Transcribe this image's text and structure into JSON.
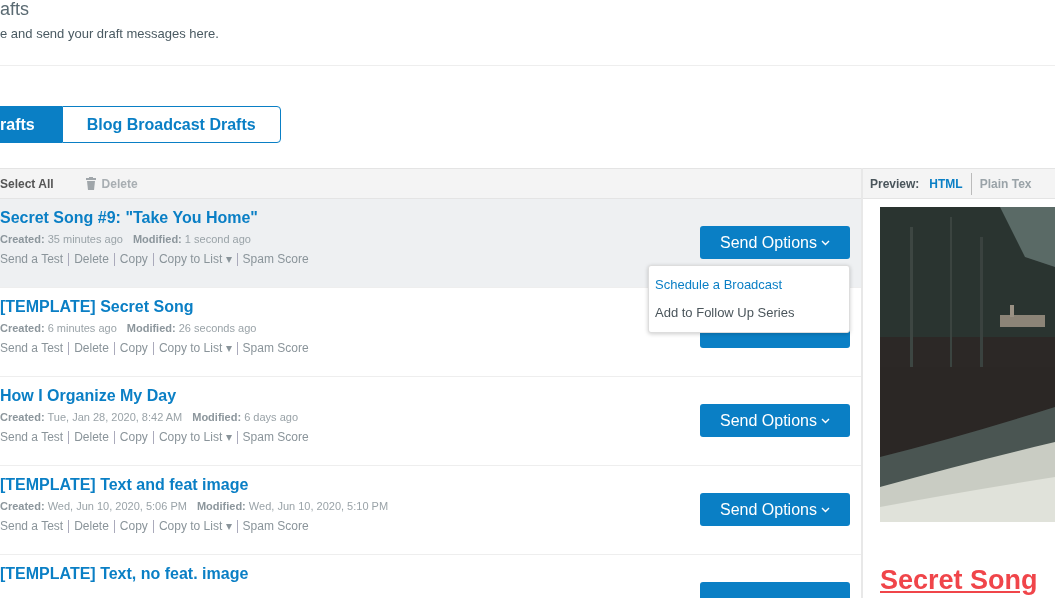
{
  "header": {
    "title": "afts",
    "subtitle": "e and send your draft messages here."
  },
  "tabs": [
    {
      "label": "rafts",
      "selected": true
    },
    {
      "label": "Blog Broadcast Drafts",
      "selected": false
    }
  ],
  "toolbar": {
    "select_all": "Select All",
    "delete": "Delete"
  },
  "drafts": [
    {
      "title": "Secret Song #9: \"Take You Home\"",
      "created_label": "Created:",
      "created": "35 minutes ago",
      "modified_label": "Modified:",
      "modified": "1 second ago",
      "actions": [
        "Send a Test",
        "Delete",
        "Copy",
        "Copy to List ▾",
        "Spam Score"
      ],
      "send_button": "Send Options",
      "selected": true
    },
    {
      "title": "[TEMPLATE] Secret Song",
      "created_label": "Created:",
      "created": "6 minutes ago",
      "modified_label": "Modified:",
      "modified": "26 seconds ago",
      "actions": [
        "Send a Test",
        "Delete",
        "Copy",
        "Copy to List ▾",
        "Spam Score"
      ],
      "selected": false
    },
    {
      "title": "How I Organize My Day",
      "created_label": "Created:",
      "created": "Tue, Jan 28, 2020, 8:42 AM",
      "modified_label": "Modified:",
      "modified": "6 days ago",
      "actions": [
        "Send a Test",
        "Delete",
        "Copy",
        "Copy to List ▾",
        "Spam Score"
      ],
      "send_button": "Send Options",
      "selected": false
    },
    {
      "title": "[TEMPLATE] Text and feat image",
      "created_label": "Created:",
      "created": "Wed, Jun 10, 2020, 5:06 PM",
      "modified_label": "Modified:",
      "modified": "Wed, Jun 10, 2020, 5:10 PM",
      "actions": [
        "Send a Test",
        "Delete",
        "Copy",
        "Copy to List ▾",
        "Spam Score"
      ],
      "send_button": "Send Options",
      "selected": false
    },
    {
      "title": "[TEMPLATE] Text, no feat. image",
      "selected": false
    }
  ],
  "send_menu": {
    "items": [
      {
        "label": "Schedule a Broadcast",
        "selected": true
      },
      {
        "label": "Add to Follow Up Series",
        "selected": false
      }
    ]
  },
  "preview": {
    "label": "Preview:",
    "modes": [
      {
        "label": "HTML",
        "selected": true
      },
      {
        "label": "Plain Tex",
        "selected": false
      }
    ],
    "heading": "Secret Song"
  }
}
